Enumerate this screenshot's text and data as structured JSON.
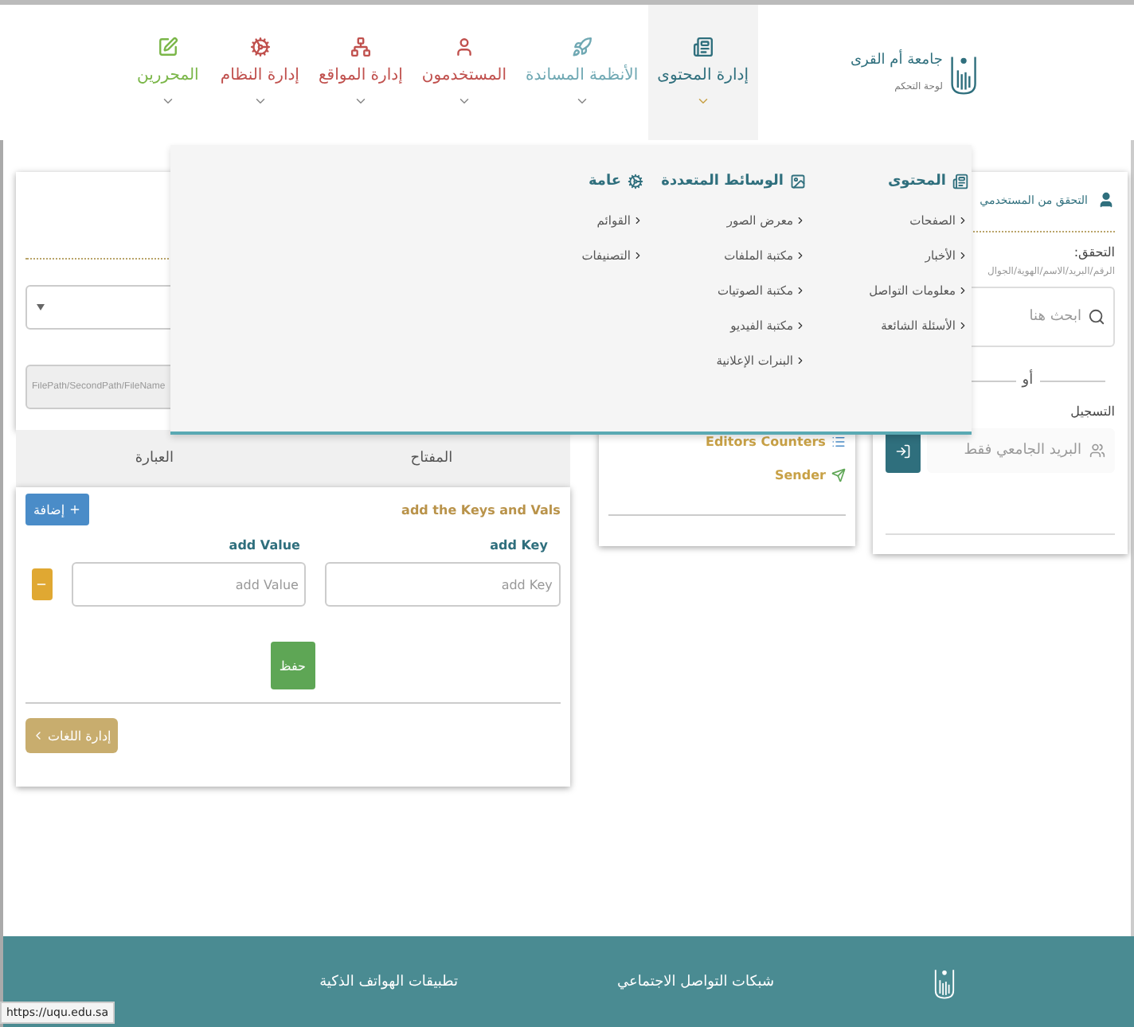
{
  "logo": {
    "title": "جامعة أم القرى",
    "subtitle": "لوحة التحكم"
  },
  "nav": [
    {
      "label": "إدارة المحتوى",
      "color": "#2f6f7d",
      "selected": true
    },
    {
      "label": "الأنظمة المساندة",
      "color": "#6fa8b3",
      "selected": false
    },
    {
      "label": "المستخدمون",
      "color": "#c0504d",
      "selected": false
    },
    {
      "label": "إدارة المواقع",
      "color": "#c0504d",
      "selected": false
    },
    {
      "label": "إدارة النظام",
      "color": "#c0504d",
      "selected": false
    },
    {
      "label": "المحررين",
      "color": "#7ab648",
      "selected": false
    }
  ],
  "mega_menu": {
    "columns": [
      {
        "title": "المحتوى",
        "items": [
          "الصفحات",
          "الأخبار",
          "معلومات التواصل",
          "الأسئلة الشائعة"
        ]
      },
      {
        "title": "الوسائط المتعددة",
        "items": [
          "معرض الصور",
          "مكتبة الملفات",
          "مكتبة الصوتيات",
          "مكتبة الفيديو",
          "البنرات الإعلانية"
        ]
      },
      {
        "title": "عامة",
        "items": [
          "القوائم",
          "التصنيفات"
        ]
      }
    ]
  },
  "left_panel": {
    "file_path": {
      "placeholder": "FilePath/SecondPath/FileName"
    },
    "table": {
      "columns": [
        "المفتاح",
        "العبارة"
      ]
    },
    "section_title": "add the Keys and Vals",
    "add_button": "إضافة",
    "key_label": "add Key",
    "value_label": "add Value",
    "key_input": {
      "placeholder": "add Key"
    },
    "value_input": {
      "placeholder": "add Value"
    },
    "save_button": "حفظ",
    "languages_button": "إدارة اللغات"
  },
  "middle_panel": {
    "items": [
      "Editors Counters",
      "Sender"
    ]
  },
  "right_panel": {
    "title": "التحقق من المستخدمي",
    "verify_label": "التحقق:",
    "verify_hint": "الرقم/البريد/الاسم/الهوية/الجوال",
    "search": {
      "placeholder": "ابحث هنا"
    },
    "or": "أو",
    "register_label": "التسجيل",
    "email": {
      "placeholder": "البريد الجامعي فقط"
    }
  },
  "footer": {
    "headings": [
      "شبكات التواصل الاجتماعي",
      "تطبيقات الهواتف الذكية"
    ]
  },
  "status_url": "https://uqu.edu.sa"
}
